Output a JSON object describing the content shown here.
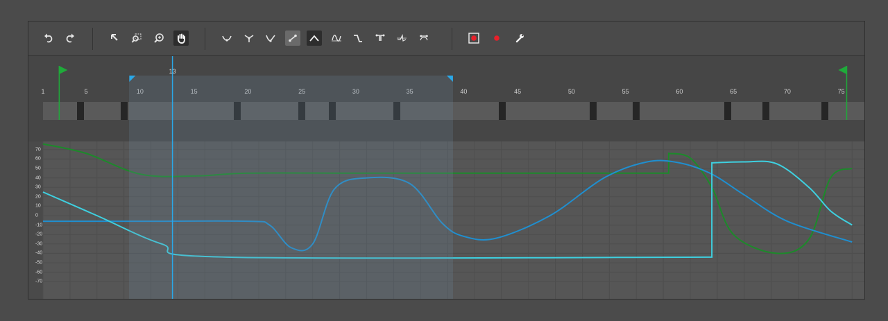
{
  "toolbar": {
    "groups": [
      [
        {
          "name": "undo-icon",
          "icon": "undo"
        },
        {
          "name": "redo-icon",
          "icon": "redo"
        }
      ],
      [
        {
          "name": "select-arrow-icon",
          "icon": "arrow"
        },
        {
          "name": "zoom-region-icon",
          "icon": "zoom-region"
        },
        {
          "name": "zoom-icon",
          "icon": "zoom"
        },
        {
          "name": "pan-hand-icon",
          "icon": "hand",
          "state": "active"
        }
      ],
      [
        {
          "name": "auto-tangent-icon",
          "icon": "curve-auto"
        },
        {
          "name": "smooth-tangent-icon",
          "icon": "curve-smooth"
        },
        {
          "name": "broken-tangent-icon",
          "icon": "curve-broken"
        },
        {
          "name": "linear-tangent-icon",
          "icon": "linear",
          "state": "toggle"
        },
        {
          "name": "peak-tangent-icon",
          "icon": "peak",
          "state": "active"
        },
        {
          "name": "wave-icon",
          "icon": "wave"
        },
        {
          "name": "step-icon",
          "icon": "step"
        },
        {
          "name": "flatten-keys-icon",
          "icon": "flatten"
        },
        {
          "name": "normalize-icon",
          "icon": "normalize"
        },
        {
          "name": "bezier-handles-icon",
          "icon": "bezier"
        }
      ],
      [
        {
          "name": "record-toggle-icon",
          "icon": "record-box"
        },
        {
          "name": "record-icon",
          "icon": "record"
        },
        {
          "name": "wrench-icon",
          "icon": "wrench"
        }
      ]
    ]
  },
  "ruler": {
    "ticks": [
      "1",
      "5",
      "10",
      "15",
      "20",
      "25",
      "30",
      "35",
      "40",
      "45",
      "50",
      "55",
      "60",
      "65",
      "70",
      "75"
    ],
    "playhead_frame": "13"
  },
  "keyframes": [
    4.5,
    8.5,
    19,
    25,
    27.8,
    33.8,
    43.6,
    52,
    56,
    64.5,
    68,
    73.5
  ],
  "range": {
    "start": 2.5,
    "end": 75.5,
    "sel_start": 9,
    "sel_end": 39
  },
  "graph": {
    "y_ticks": [
      "70",
      "60",
      "50",
      "40",
      "30",
      "20",
      "10",
      "0",
      "-10",
      "-20",
      "-30",
      "-40",
      "-50",
      "-60",
      "-70"
    ],
    "curves": [
      {
        "name": "green-curve",
        "color": "#1c8a2a",
        "points": [
          [
            1,
            76
          ],
          [
            5,
            66
          ],
          [
            10,
            44
          ],
          [
            15,
            42
          ],
          [
            20,
            45
          ],
          [
            30,
            45
          ],
          [
            40,
            45
          ],
          [
            50,
            45
          ],
          [
            59,
            45
          ],
          [
            59,
            66
          ],
          [
            61,
            61
          ],
          [
            63,
            30
          ],
          [
            65,
            -20
          ],
          [
            69,
            -40
          ],
          [
            72,
            -25
          ],
          [
            74,
            40
          ],
          [
            76,
            50
          ]
        ]
      },
      {
        "name": "blue-curve",
        "color": "#1f8fd0",
        "points": [
          [
            1,
            -6
          ],
          [
            10,
            -6
          ],
          [
            20,
            -6
          ],
          [
            22,
            -10
          ],
          [
            24,
            -34
          ],
          [
            26,
            -30
          ],
          [
            28,
            28
          ],
          [
            31,
            40
          ],
          [
            35,
            34
          ],
          [
            38,
            -8
          ],
          [
            40,
            -22
          ],
          [
            43,
            -24
          ],
          [
            48,
            0
          ],
          [
            53,
            40
          ],
          [
            57,
            57
          ],
          [
            60,
            56
          ],
          [
            63,
            44
          ],
          [
            66,
            22
          ],
          [
            70,
            -6
          ],
          [
            76,
            -28
          ]
        ]
      },
      {
        "name": "cyan-curve",
        "color": "#3ed0e0",
        "points": [
          [
            1,
            25
          ],
          [
            6,
            0
          ],
          [
            12,
            -30
          ],
          [
            18,
            -44
          ],
          [
            63,
            -44
          ],
          [
            63,
            56
          ],
          [
            66,
            57
          ],
          [
            69,
            55
          ],
          [
            72,
            30
          ],
          [
            74,
            5
          ],
          [
            76,
            -10
          ]
        ]
      }
    ]
  }
}
